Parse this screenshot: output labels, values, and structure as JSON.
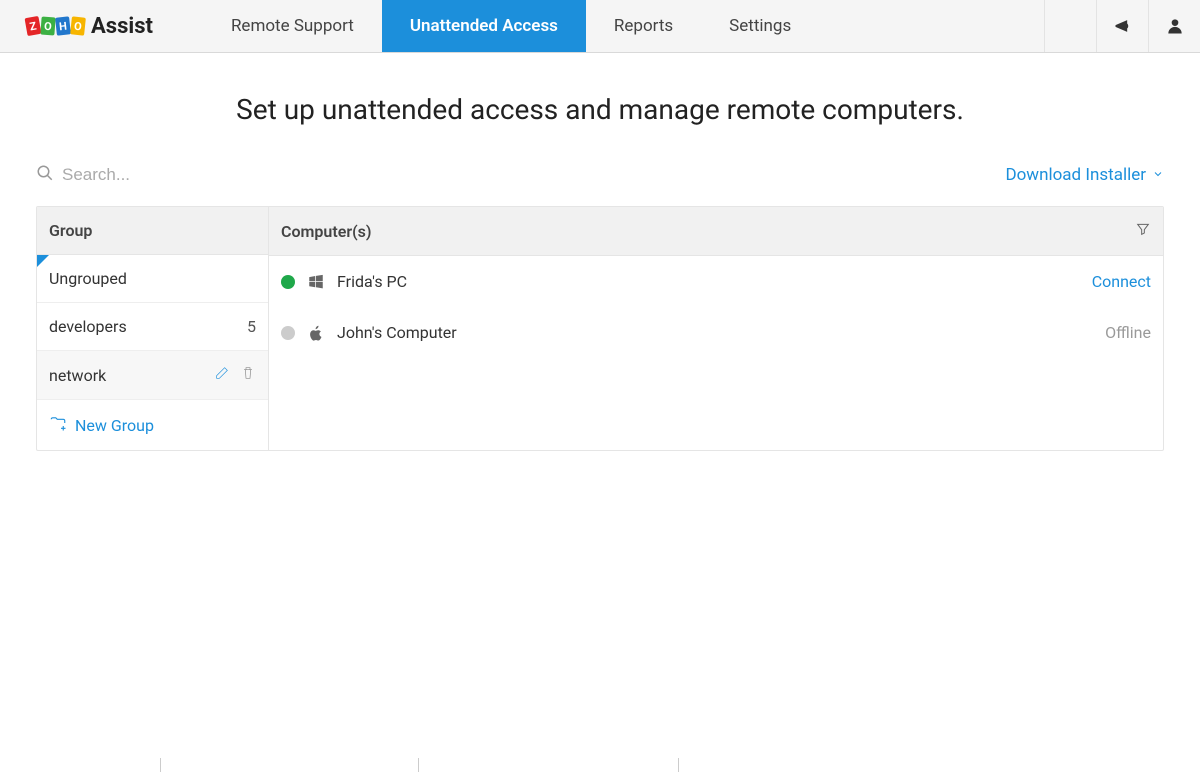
{
  "brand": {
    "logo_letters": [
      "Z",
      "O",
      "H",
      "O"
    ],
    "name": "Assist"
  },
  "nav": {
    "items": [
      {
        "label": "Remote Support"
      },
      {
        "label": "Unattended Access",
        "active": true
      },
      {
        "label": "Reports"
      },
      {
        "label": "Settings"
      }
    ]
  },
  "hero": {
    "title": "Set up unattended access and manage remote computers."
  },
  "search": {
    "placeholder": "Search..."
  },
  "download": {
    "label": "Download Installer"
  },
  "headers": {
    "group": "Group",
    "computers": "Computer(s)"
  },
  "groups": [
    {
      "name": "Ungrouped",
      "active": true
    },
    {
      "name": "developers",
      "count": "5"
    },
    {
      "name": "network",
      "hover": true
    }
  ],
  "new_group_label": "New Group",
  "computers": [
    {
      "name": "Frida's PC",
      "os": "windows",
      "status": "online",
      "action": "Connect"
    },
    {
      "name": "John's Computer",
      "os": "apple",
      "status": "offline",
      "action": "Offline"
    }
  ]
}
